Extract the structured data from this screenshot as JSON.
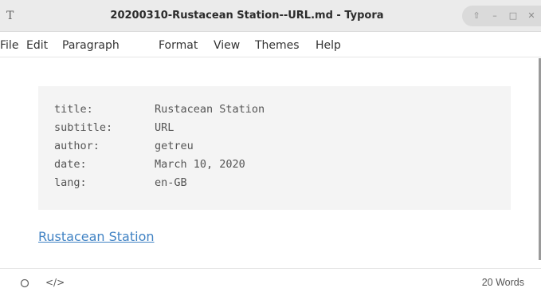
{
  "window": {
    "app_icon": "T",
    "title": "20200310-Rustacean Station--URL.md - Typora",
    "controls": {
      "up": "⇧",
      "minimize": "–",
      "maximize": "□",
      "close": "✕"
    }
  },
  "menu": [
    "File",
    "Edit",
    "Paragraph",
    "Format",
    "View",
    "Themes",
    "Help"
  ],
  "front_matter": [
    {
      "key": "title:",
      "value": "Rustacean Station"
    },
    {
      "key": "subtitle:",
      "value": "URL"
    },
    {
      "key": "author:",
      "value": "getreu"
    },
    {
      "key": "date:",
      "value": "March 10, 2020"
    },
    {
      "key": "lang:",
      "value": "en-GB"
    }
  ],
  "body": {
    "link_text": "Rustacean Station",
    "link_color": "#4183c4"
  },
  "status": {
    "outline_icon": "circle-outline-icon",
    "source_icon": "code-icon",
    "source_label": "</>",
    "word_count": "20 Words"
  }
}
